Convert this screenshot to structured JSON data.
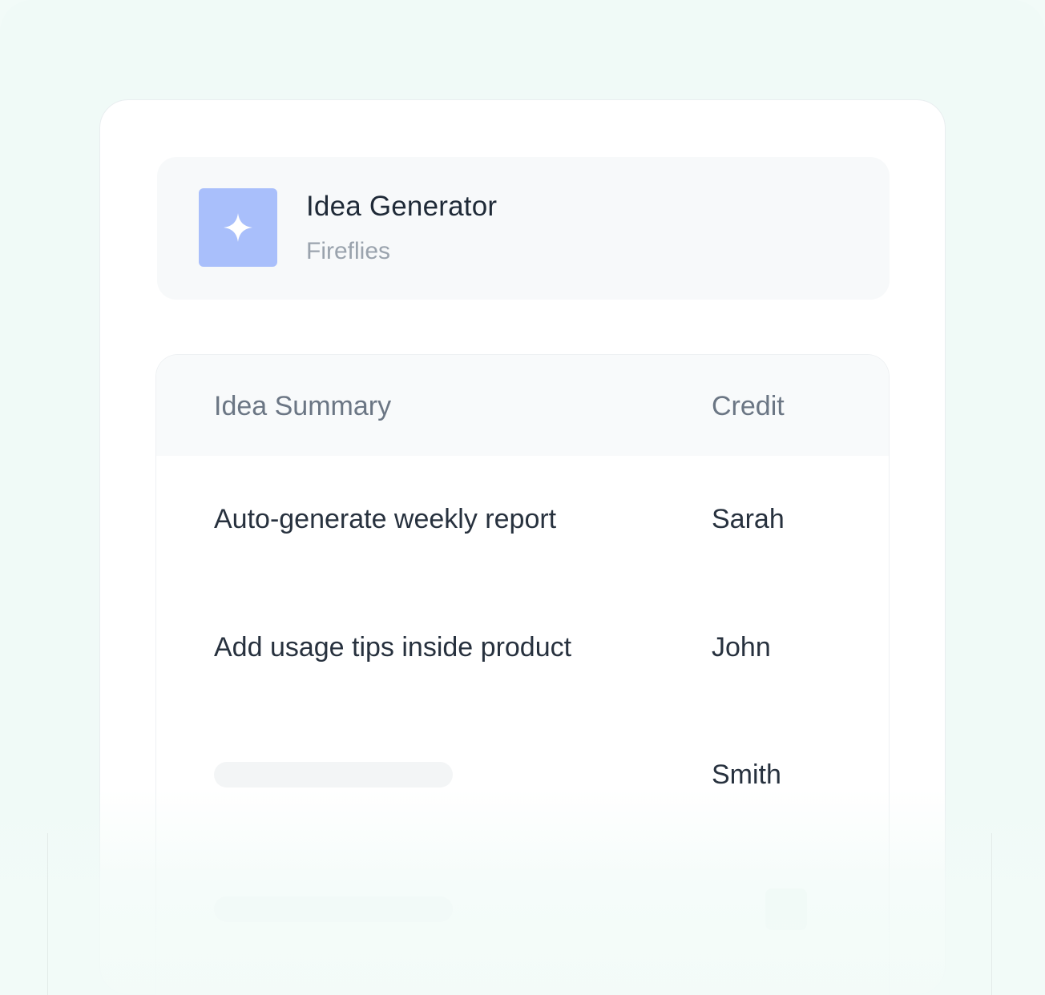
{
  "app": {
    "title": "Idea Generator",
    "subtitle": "Fireflies",
    "icon": "sparkle-icon",
    "icon_color": "#a9bffb"
  },
  "table": {
    "headers": [
      "Idea Summary",
      "Credit"
    ],
    "rows": [
      {
        "summary": "Auto-generate weekly report",
        "credit": "Sarah"
      },
      {
        "summary": "Add usage tips inside product",
        "credit": "John"
      },
      {
        "summary": "",
        "credit": "Smith"
      },
      {
        "summary": "",
        "credit": ""
      }
    ]
  },
  "colors": {
    "background": "#f2fbf8",
    "card": "#ffffff",
    "header_band": "#f8fafb",
    "text_primary": "#27313e",
    "text_muted": "#9aa3ad"
  }
}
